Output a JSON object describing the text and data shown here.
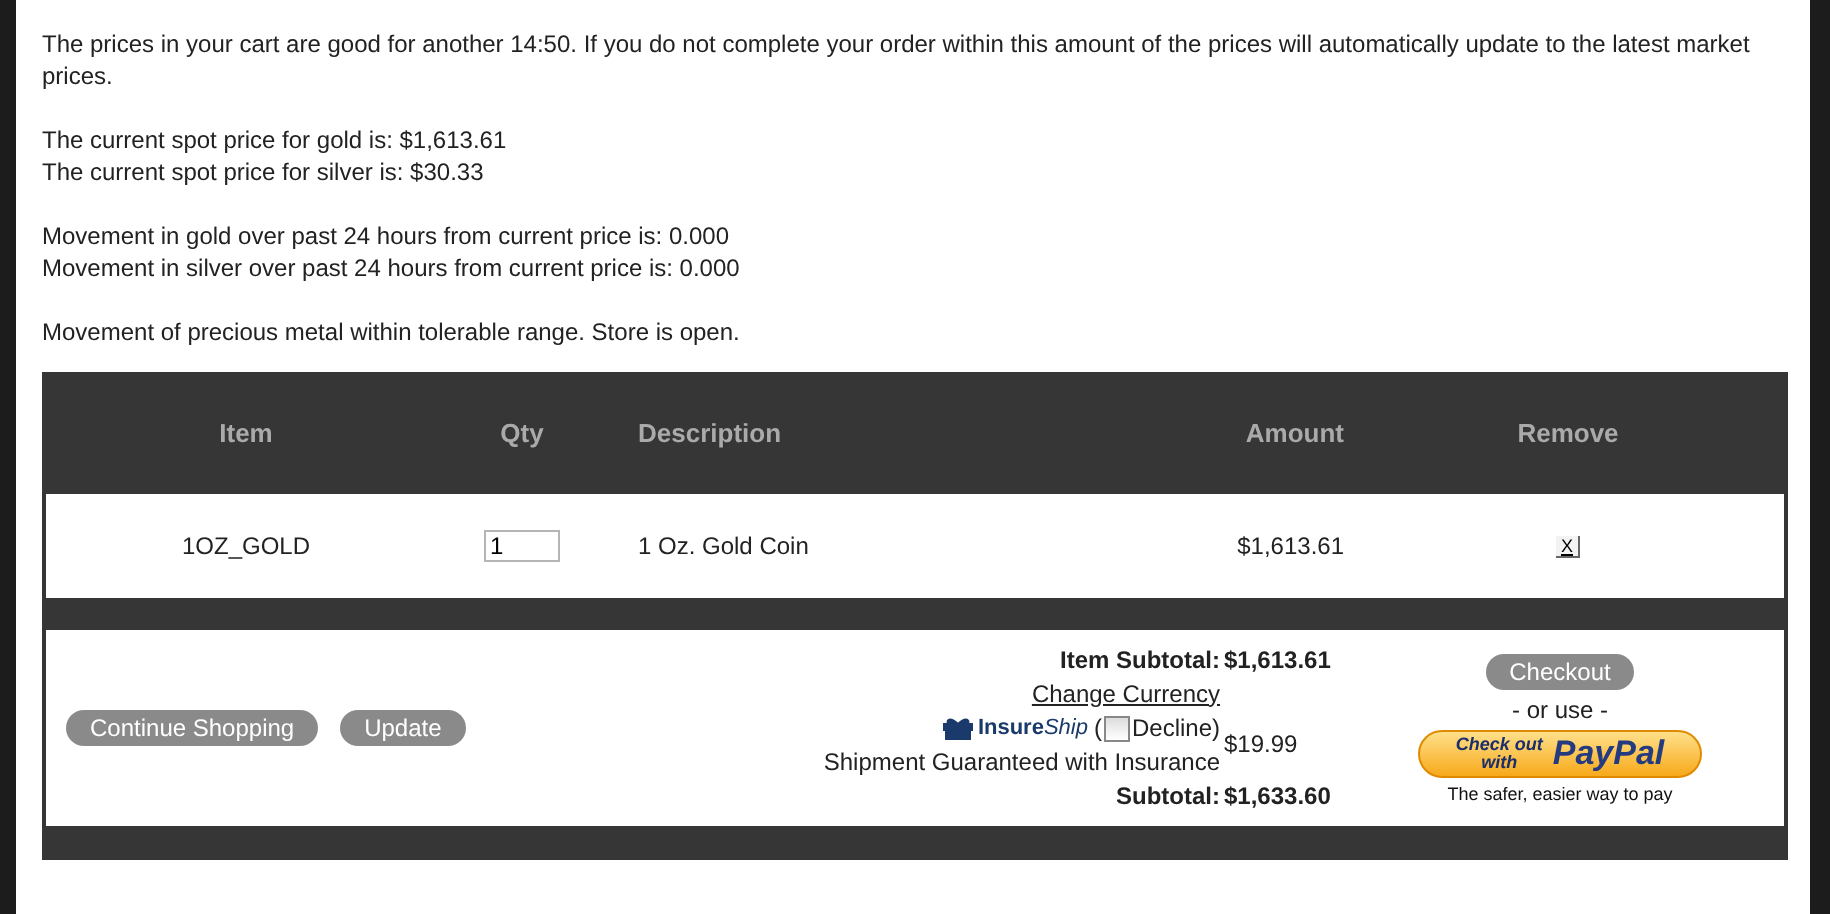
{
  "notice": {
    "paragraphs": [
      [
        "The prices in your cart are good for another 14:50. If you do not complete your order within this amount of the prices will automatically update to the latest market prices."
      ],
      [
        "The current spot price for gold is: $1,613.61",
        "The current spot price for silver is: $30.33"
      ],
      [
        "Movement in gold over past 24 hours from current price is: 0.000",
        "Movement in silver over past 24 hours from current price is: 0.000"
      ],
      [
        "Movement of precious metal within tolerable range. Store is open."
      ]
    ]
  },
  "cart": {
    "columns": [
      "Item",
      "Qty",
      "Description",
      "Amount",
      "Remove"
    ],
    "rows": [
      {
        "item": "1OZ_GOLD",
        "qty": "1",
        "description": "1 Oz. Gold Coin",
        "amount": "$1,613.61",
        "remove": "X"
      }
    ],
    "footer": {
      "buttons": [
        "Continue Shopping",
        "Update"
      ],
      "item_subtotal": {
        "label": "Item Subtotal:",
        "value": "$1,613.61"
      },
      "change_currency": "Change Currency",
      "insurance": {
        "logo_strong": "Insure",
        "logo_light": "Ship",
        "open_paren": "(",
        "decline_label": "Decline)",
        "decline_checked": false,
        "description": "Shipment Guaranteed with Insurance",
        "price": "$19.99"
      },
      "subtotal": {
        "label": "Subtotal:",
        "value": "$1,633.60"
      },
      "checkout": "Checkout",
      "or_use": "- or use -",
      "paypal": {
        "line_1": "Check out",
        "line_2": "with",
        "brand": "PayPal",
        "tagline": "The safer, easier way to pay"
      }
    }
  }
}
